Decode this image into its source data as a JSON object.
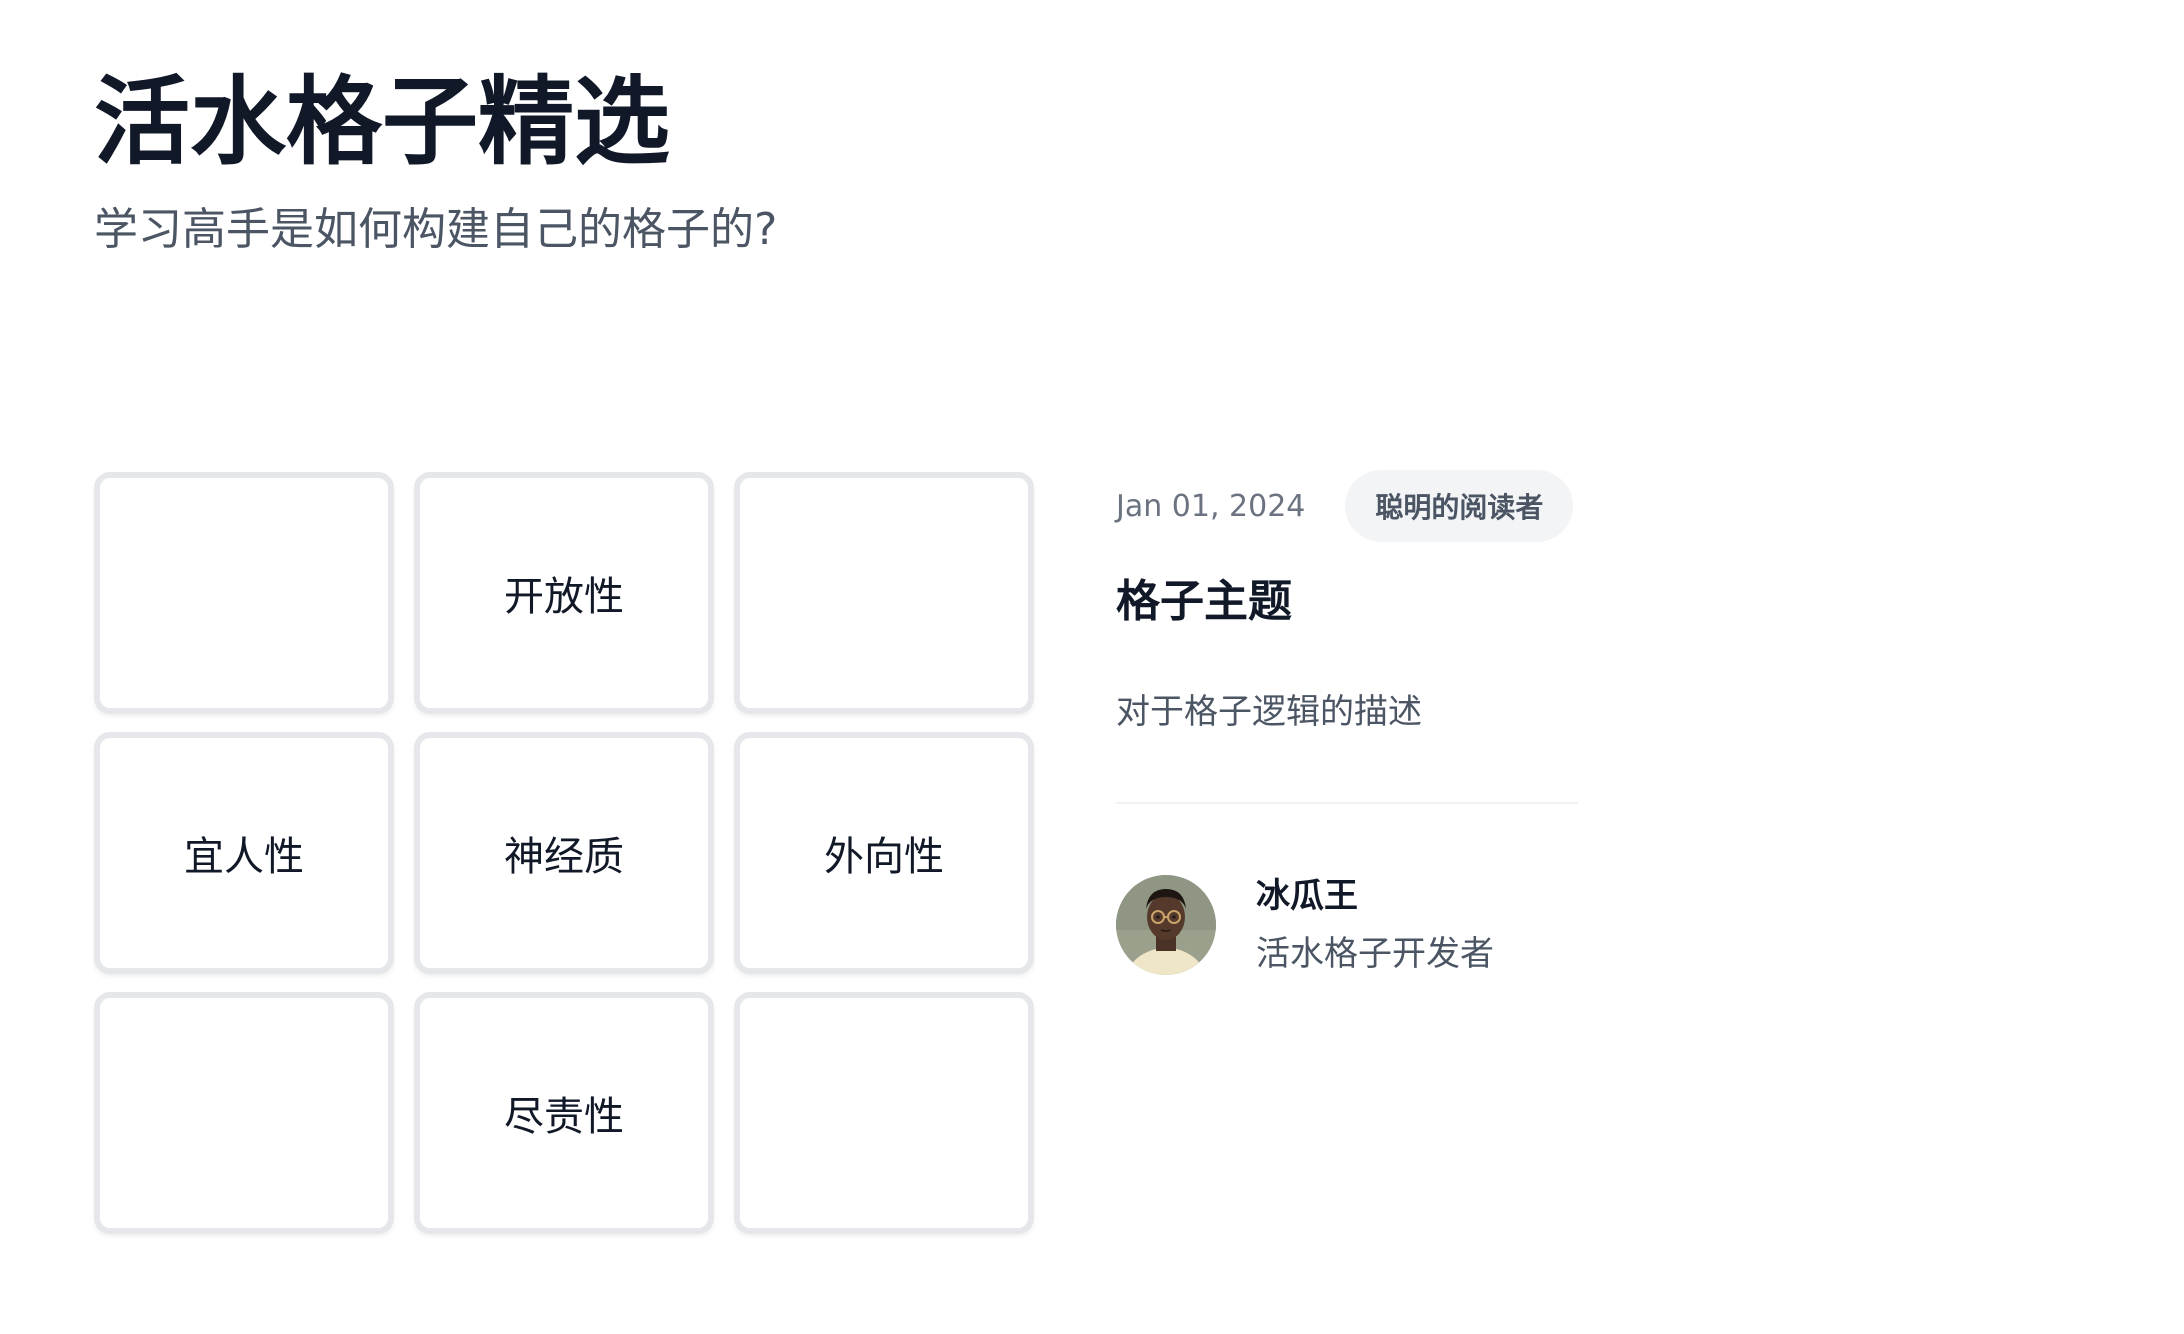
{
  "header": {
    "title": "活水格子精选",
    "subtitle": "学习高手是如何构建自己的格子的?"
  },
  "grid": {
    "cells": [
      {
        "label": ""
      },
      {
        "label": "开放性"
      },
      {
        "label": ""
      },
      {
        "label": "宜人性"
      },
      {
        "label": "神经质"
      },
      {
        "label": "外向性"
      },
      {
        "label": ""
      },
      {
        "label": "尽责性"
      },
      {
        "label": ""
      }
    ]
  },
  "post": {
    "date": "Jan 01, 2024",
    "category": "聪明的阅读者",
    "title": "格子主题",
    "description": "对于格子逻辑的描述"
  },
  "author": {
    "name": "冰瓜王",
    "role": "活水格子开发者"
  },
  "colors": {
    "text_primary": "#111827",
    "text_secondary": "#4b5563",
    "cell_border": "#e5e7eb",
    "badge_bg": "#f3f4f6"
  }
}
